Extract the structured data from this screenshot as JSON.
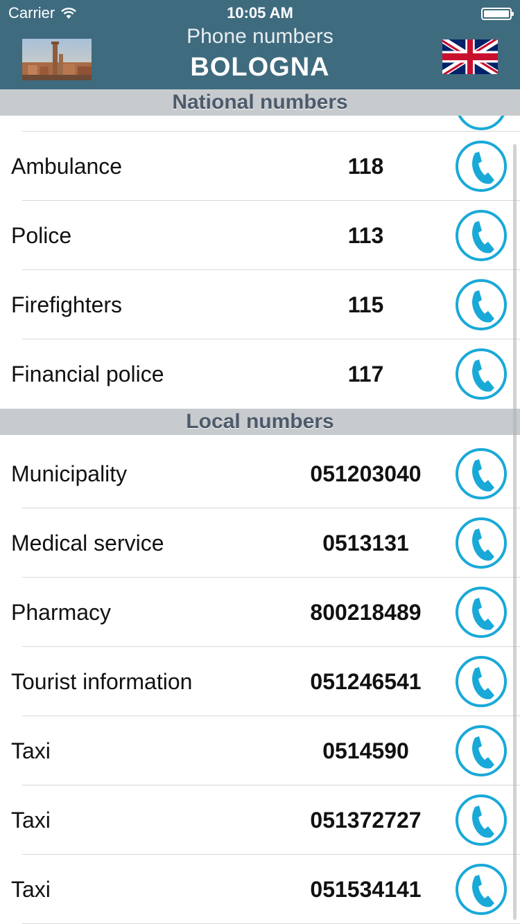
{
  "status_bar": {
    "carrier": "Carrier",
    "time": "10:05 AM"
  },
  "header": {
    "subtitle": "Phone numbers",
    "title": "BOLOGNA",
    "city_photo_icon": "bologna-towers-photo",
    "language_icon": "uk-flag-icon"
  },
  "national": {
    "header": "National numbers",
    "items": [
      {
        "label": "Ambulance",
        "number": "118"
      },
      {
        "label": "Police",
        "number": "113"
      },
      {
        "label": "Firefighters",
        "number": "115"
      },
      {
        "label": "Financial police",
        "number": "117"
      }
    ]
  },
  "local": {
    "header": "Local numbers",
    "items": [
      {
        "label": "Municipality",
        "number": "051203040"
      },
      {
        "label": "Medical service",
        "number": "0513131"
      },
      {
        "label": "Pharmacy",
        "number": "800218489"
      },
      {
        "label": "Tourist information",
        "number": "051246541"
      },
      {
        "label": "Taxi",
        "number": "0514590"
      },
      {
        "label": "Taxi",
        "number": "051372727"
      },
      {
        "label": "Taxi",
        "number": "051534141"
      }
    ]
  },
  "colors": {
    "header_bg": "#3f6b7f",
    "section_bg": "#c8cbce",
    "call_icon": "#19a9d8"
  }
}
